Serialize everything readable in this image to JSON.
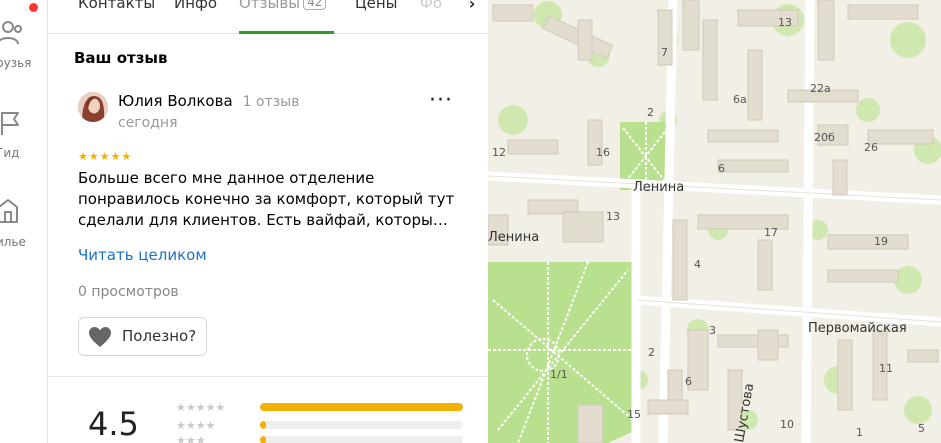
{
  "rail": {
    "items": [
      {
        "label": "рузья"
      },
      {
        "label": "Гид"
      },
      {
        "label": "илье"
      }
    ]
  },
  "tabs": [
    {
      "label": "Контакты"
    },
    {
      "label": "Инфо"
    },
    {
      "label": "Отзывы",
      "count": "42",
      "active": true
    },
    {
      "label": "Цены"
    },
    {
      "label": "Фо"
    }
  ],
  "review": {
    "section_title": "Ваш отзыв",
    "author": "Юлия Волкова",
    "author_reviews": "1 отзыв",
    "date": "сегодня",
    "stars": 5,
    "stars_text": "★★★★★",
    "text": "Больше всего мне данное отделение понравилось конечно за комфорт, который тут сделали для клиентов. Есть вайфай, которы…",
    "read_more": "Читать целиком",
    "views": "0 просмотров",
    "useful_label": "Полезно?"
  },
  "rating": {
    "value": "4.5",
    "distribution": [
      {
        "stars": "★★★★★",
        "fraction": 1.0
      },
      {
        "stars": "★★★★",
        "fraction": 0.03
      },
      {
        "stars": "★★★",
        "fraction": 0.03
      }
    ]
  },
  "map": {
    "streets": [
      "Ленина",
      "Первомайская",
      "Шустова",
      "Ленина"
    ],
    "house_numbers": [
      "13",
      "7",
      "6а",
      "22а",
      "2",
      "20б",
      "26",
      "12",
      "16",
      "6",
      "13",
      "17",
      "19",
      "4",
      "3",
      "2",
      "6",
      "11",
      "1/1",
      "15",
      "10",
      "1",
      "5"
    ],
    "colors": {
      "background": "#f2efe6",
      "building": "#e3ddd0",
      "building_stroke": "#d0c8b8",
      "park": "#b9e08e",
      "road": "#ffffff"
    }
  },
  "colors": {
    "accent": "#2e9a2e",
    "link": "#1a73c9",
    "star": "#f3b000"
  }
}
